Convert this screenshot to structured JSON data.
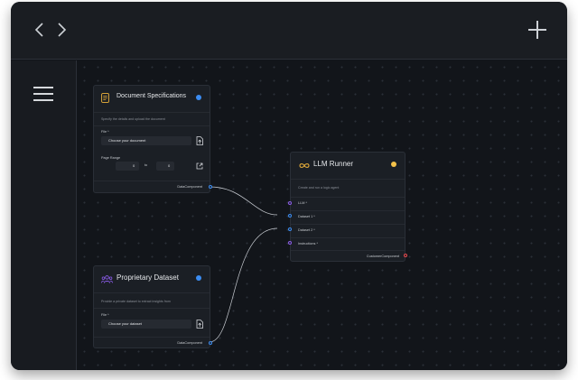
{
  "topbar": {
    "back_icon": "chevron-left-icon",
    "forward_icon": "chevron-right-icon",
    "add_icon": "plus-icon"
  },
  "sidebar": {
    "menu_icon": "hamburger-menu-icon"
  },
  "colors": {
    "wire": "#c8ccd2",
    "blue": "#3b8cf2",
    "purple": "#8a5be8",
    "yellow": "#f4c24a",
    "red": "#e5484d",
    "orange": "#f0b43b"
  },
  "nodes": {
    "doc_spec": {
      "title": "Document Specifications",
      "description": "Specify the details and upload the document",
      "file_label": "File *",
      "file_placeholder": "Choose your document",
      "page_range_label": "Page Range",
      "from_value": "0",
      "to_label": "to",
      "to_value": "0",
      "output_label": "DataComponent"
    },
    "prop_dataset": {
      "title": "Proprietary Dataset",
      "description": "Provide a private dataset to extract insights from",
      "file_label": "File *",
      "file_placeholder": "Choose your dataset",
      "output_label": "DataComponent"
    },
    "llm_runner": {
      "title": "LLM Runner",
      "description": "Create and run a logic agent",
      "inputs": [
        "LLM *",
        "Dataset 1 *",
        "Dataset 2 *",
        "Instructions *"
      ],
      "output_label": "CustomerComponent"
    }
  }
}
